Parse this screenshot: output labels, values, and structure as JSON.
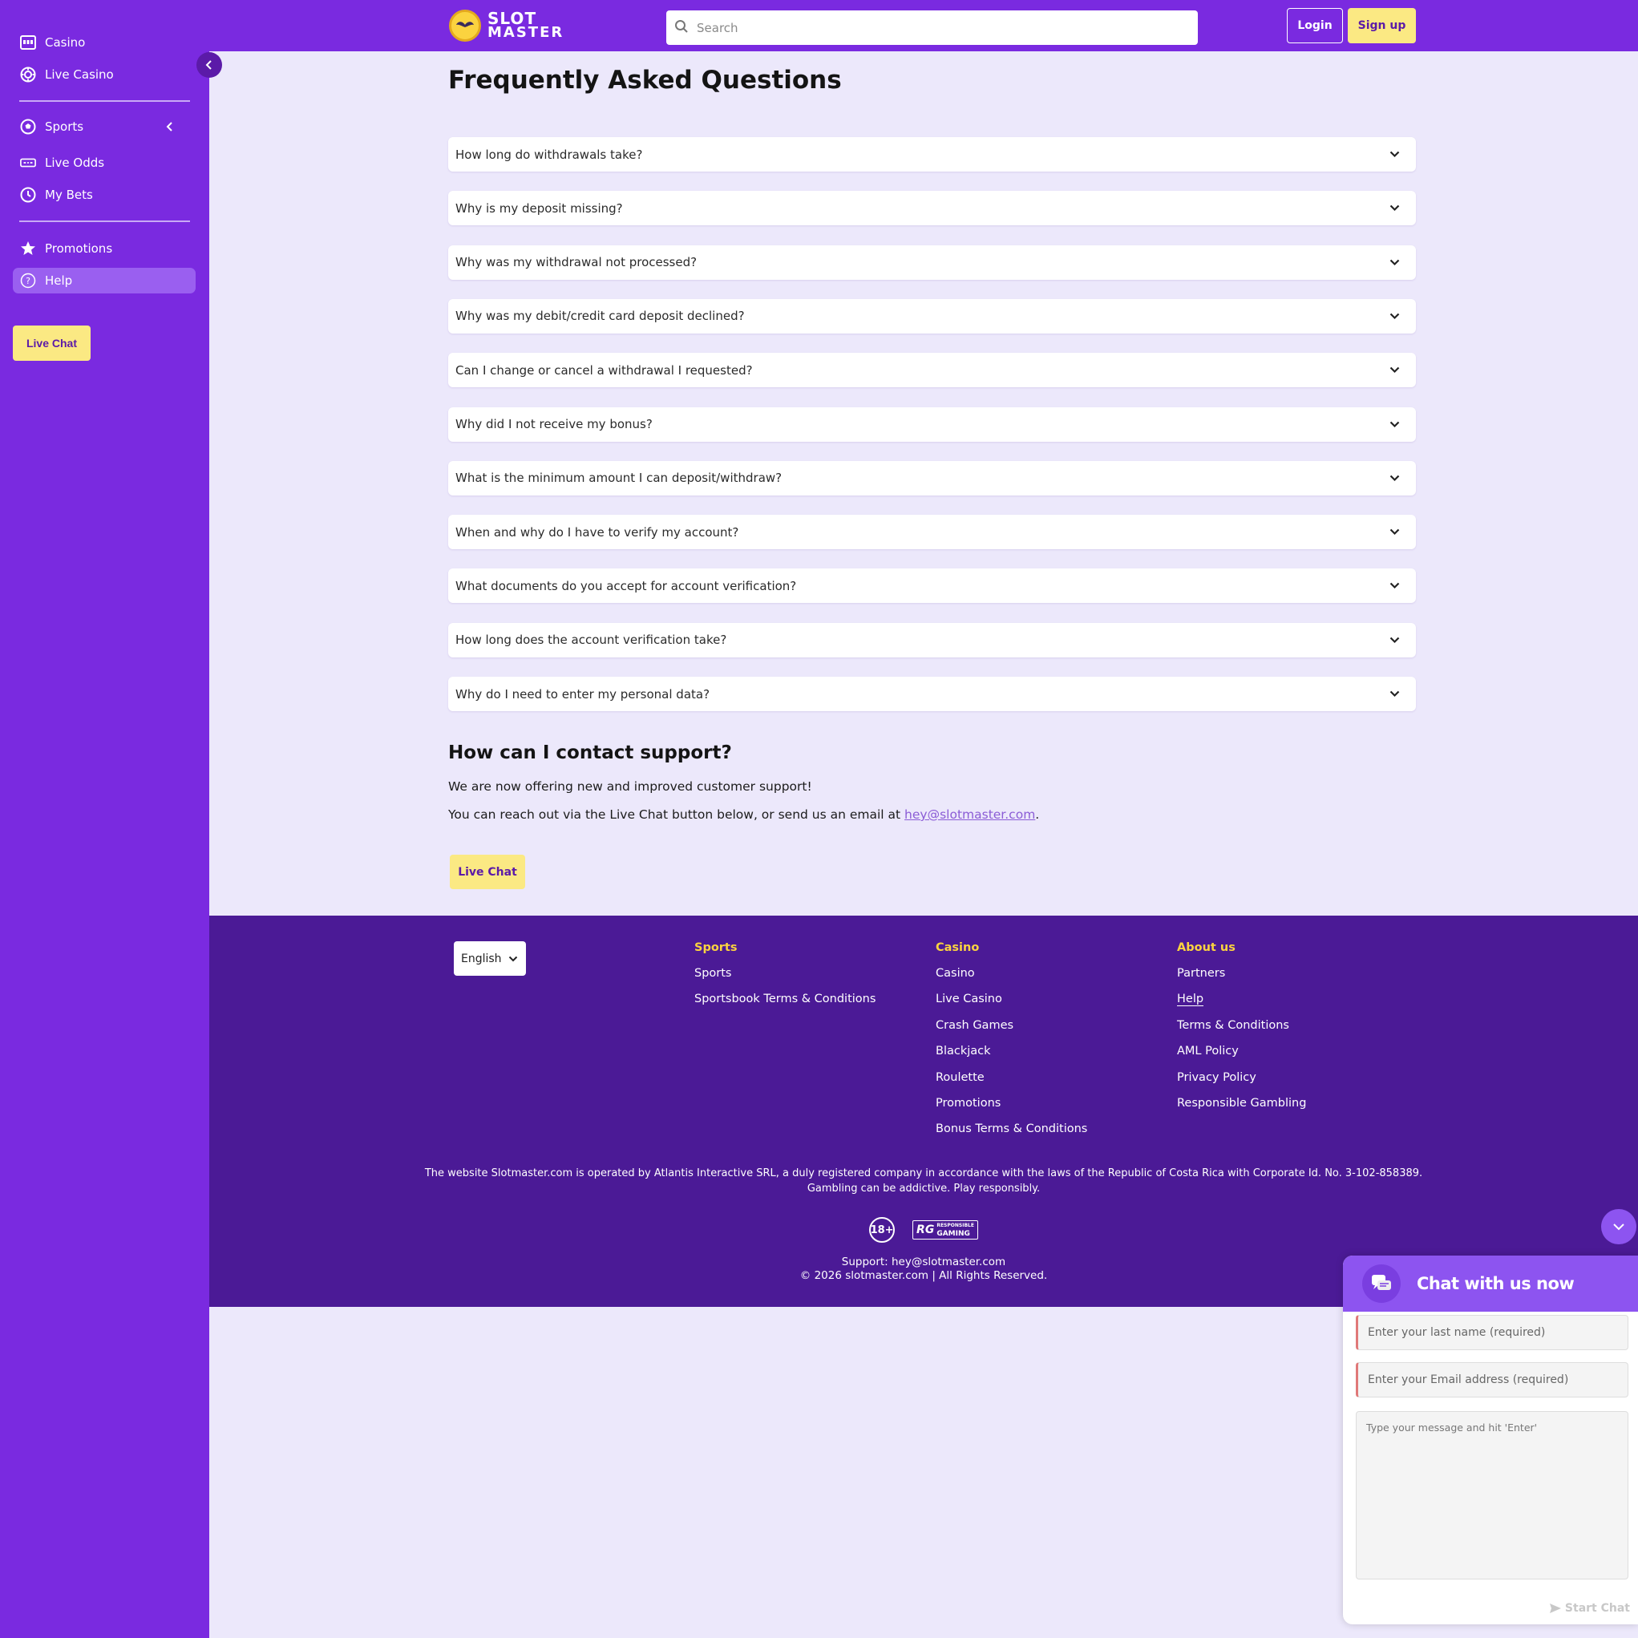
{
  "sidebar": {
    "items": [
      {
        "label": "Casino",
        "icon": "slot-machine-icon"
      },
      {
        "label": "Live Casino",
        "icon": "chip-icon"
      },
      {
        "label": "Sports",
        "icon": "soccer-ball-icon"
      },
      {
        "label": "Live Odds",
        "icon": "scoreboard-icon"
      },
      {
        "label": "My Bets",
        "icon": "clock-icon"
      },
      {
        "label": "Promotions",
        "icon": "star-icon"
      },
      {
        "label": "Help",
        "icon": "question-icon",
        "active": true
      }
    ],
    "live_chat_label": "Live Chat"
  },
  "header": {
    "logo_line1": "SLOT",
    "logo_line2": "MASTER",
    "search_placeholder": "Search",
    "login_label": "Login",
    "signup_label": "Sign up"
  },
  "main": {
    "title": "Frequently Asked Questions",
    "faqs": [
      "How long do withdrawals take?",
      "Why is my deposit missing?",
      "Why was my withdrawal not processed?",
      "Why was my debit/credit card deposit declined?",
      "Can I change or cancel a withdrawal I requested?",
      "Why did I not receive my bonus?",
      "What is the minimum amount I can deposit/withdraw?",
      "When and why do I have to verify my account?",
      "What documents do you accept for account verification?",
      "How long does the account verification take?",
      "Why do I need to enter my personal data?"
    ],
    "contact_title": "How can I contact support?",
    "contact_p1": "We are now offering new and improved customer support!",
    "contact_p2_prefix": "You can reach out via the Live Chat button below, or send us an email at ",
    "contact_email": "hey@slotmaster.com",
    "contact_p2_suffix": ".",
    "live_chat_label": "Live Chat"
  },
  "footer": {
    "language": "English",
    "columns": [
      {
        "title": "Sports",
        "links": [
          "Sports",
          "Sportsbook Terms & Conditions"
        ]
      },
      {
        "title": "Casino",
        "links": [
          "Casino",
          "Live Casino",
          "Crash Games",
          "Blackjack",
          "Roulette",
          "Promotions",
          "Bonus Terms & Conditions"
        ]
      },
      {
        "title": "About us",
        "links": [
          "Partners",
          "Help",
          "Terms & Conditions",
          "AML Policy",
          "Privacy Policy",
          "Responsible Gambling"
        ]
      }
    ],
    "legal_line1": "The website Slotmaster.com is operated by Atlantis Interactive SRL, a duly registered company in accordance with the laws of the Republic of Costa Rica with Corporate Id. No. 3-102-858389.",
    "legal_line2": "Gambling can be addictive. Play responsibly.",
    "badge_18": "18+",
    "badge_rg_mark": "RG",
    "badge_rg_line1": "RESPONSIBLE",
    "badge_rg_line2": "GAMING",
    "support_line": "Support: hey@slotmaster.com",
    "copyright": "© 2026 slotmaster.com | All Rights Reserved."
  },
  "chat_widget": {
    "title": "Chat with us now",
    "last_name_placeholder": "Enter your last name (required)",
    "email_placeholder": "Enter your Email address (required)",
    "message_placeholder": "Type your message and hit 'Enter'",
    "start_label": "Start Chat"
  },
  "colors": {
    "brand_purple": "#7a2ae0",
    "footer_purple": "#4b1a96",
    "accent_yellow": "#fbe983",
    "page_bg": "#ece8fb"
  }
}
